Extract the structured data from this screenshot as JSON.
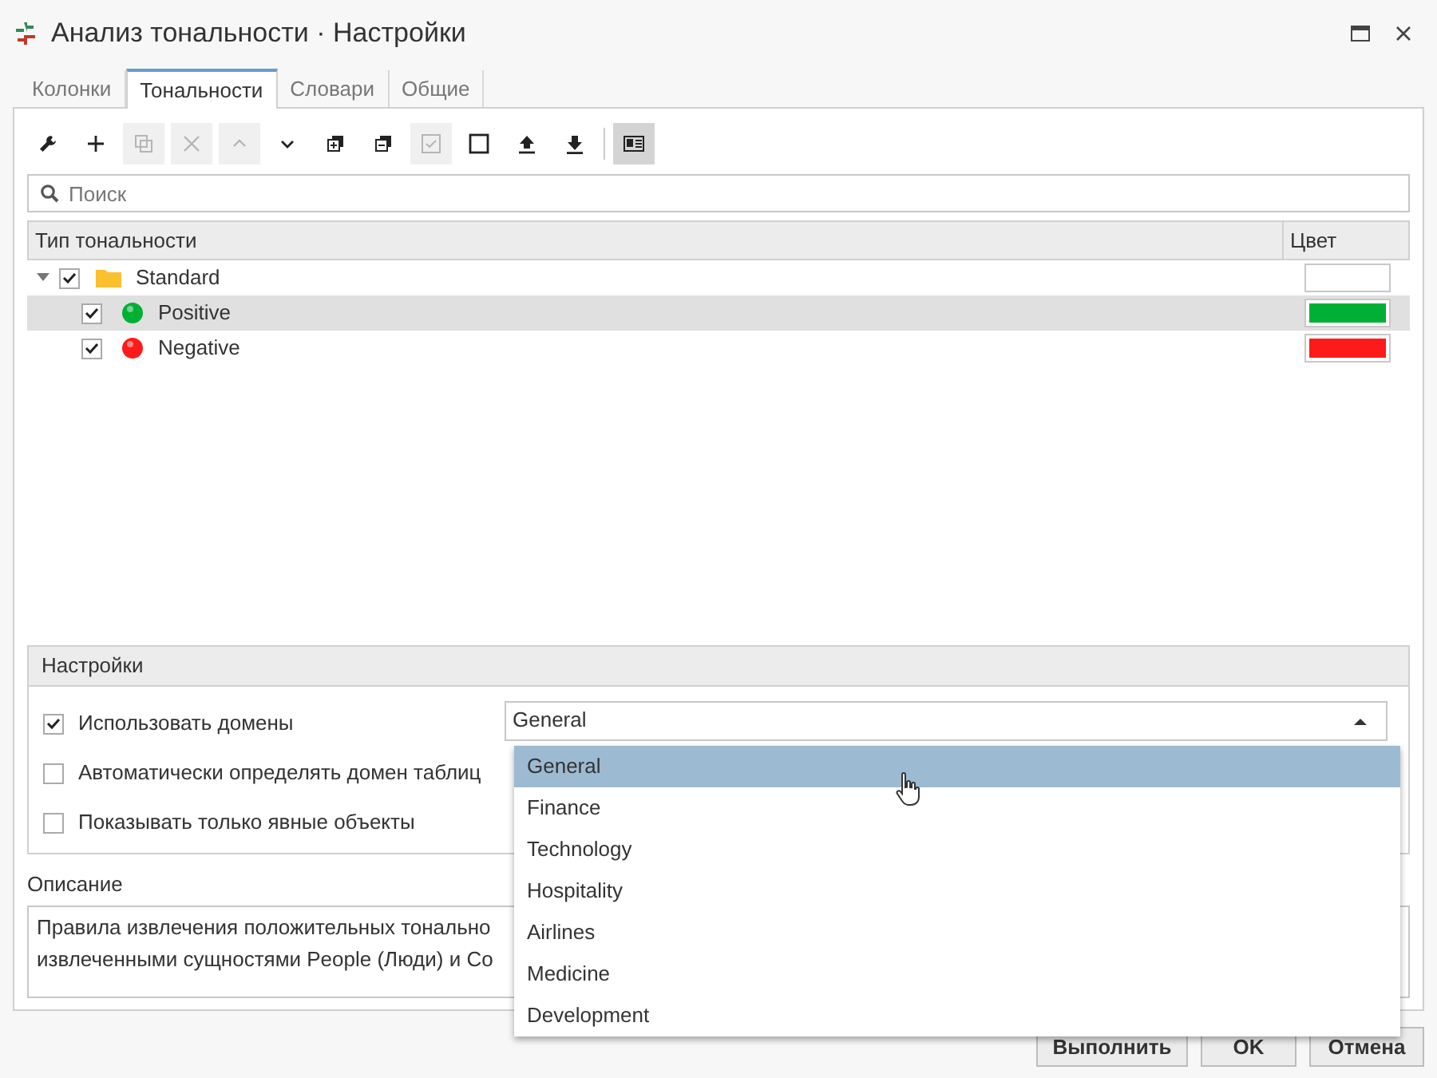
{
  "window": {
    "title": "Анализ тональности · Настройки"
  },
  "tabs": [
    {
      "label": "Колонки",
      "selected": false
    },
    {
      "label": "Тональности",
      "selected": true
    },
    {
      "label": "Словари",
      "selected": false
    },
    {
      "label": "Общие",
      "selected": false
    }
  ],
  "toolbar": [
    {
      "kind": "wrench",
      "disabled": false,
      "pressed": false
    },
    {
      "kind": "add",
      "disabled": false,
      "pressed": false
    },
    {
      "kind": "copy",
      "disabled": true,
      "pressed": false
    },
    {
      "kind": "delete",
      "disabled": true,
      "pressed": false
    },
    {
      "kind": "up",
      "disabled": true,
      "pressed": false
    },
    {
      "kind": "down",
      "disabled": false,
      "pressed": false
    },
    {
      "kind": "expand",
      "disabled": false,
      "pressed": false
    },
    {
      "kind": "collapse",
      "disabled": false,
      "pressed": false
    },
    {
      "kind": "check",
      "disabled": true,
      "pressed": false
    },
    {
      "kind": "uncheck",
      "disabled": false,
      "pressed": false
    },
    {
      "kind": "import",
      "disabled": false,
      "pressed": false
    },
    {
      "kind": "export",
      "disabled": false,
      "pressed": false
    },
    {
      "kind": "separator"
    },
    {
      "kind": "view",
      "disabled": false,
      "pressed": true
    }
  ],
  "search": {
    "placeholder": "Поиск"
  },
  "table": {
    "columns": [
      "Тип тональности",
      "Цвет"
    ],
    "rows": [
      {
        "kind": "folder",
        "label": "Standard",
        "expanded": true,
        "checked": true,
        "selected": false,
        "color": "#ffffff",
        "children": [
          {
            "kind": "item",
            "label": "Positive",
            "checked": true,
            "selected": true,
            "color": "#00b034"
          },
          {
            "kind": "item",
            "label": "Negative",
            "checked": true,
            "selected": false,
            "color": "#ff1a1a"
          }
        ]
      }
    ]
  },
  "settings": {
    "title": "Настройки",
    "options": [
      {
        "label": "Использовать домены",
        "checked": true
      },
      {
        "label": "Автоматически определять домен таблиц",
        "checked": false
      },
      {
        "label": "Показывать только явные объекты",
        "checked": false
      }
    ],
    "domain": {
      "value": "General",
      "expanded": true,
      "options": [
        {
          "label": "General",
          "selected": true
        },
        {
          "label": "Finance",
          "selected": false
        },
        {
          "label": "Technology",
          "selected": false
        },
        {
          "label": "Hospitality",
          "selected": false
        },
        {
          "label": "Airlines",
          "selected": false
        },
        {
          "label": "Medicine",
          "selected": false
        },
        {
          "label": "Development",
          "selected": false
        }
      ]
    }
  },
  "description": {
    "label": "Описание",
    "lines": [
      "Правила извлечения положительных тонально",
      "извлеченными сущностями People (Люди) и Co"
    ]
  },
  "buttons": [
    "Выполнить",
    "OK",
    "Отмена"
  ]
}
